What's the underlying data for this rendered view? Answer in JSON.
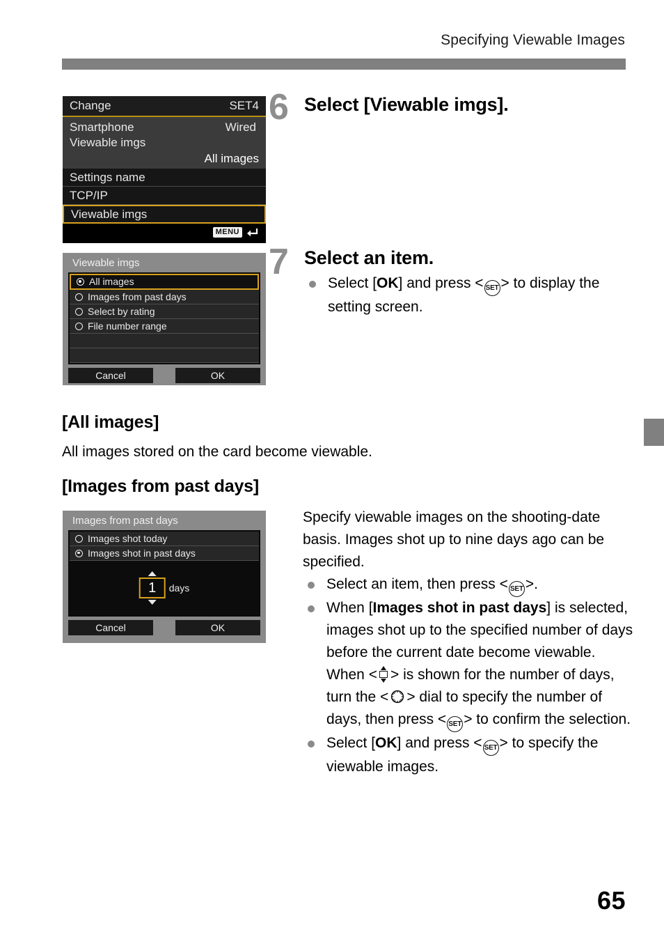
{
  "page": {
    "running_header": "Specifying Viewable Images",
    "page_number": "65"
  },
  "steps": [
    {
      "number": "6",
      "title": "Select [Viewable imgs]."
    },
    {
      "number": "7",
      "title": "Select an item.",
      "bullets": [
        {
          "parts": [
            {
              "type": "text",
              "value": "Select ["
            },
            {
              "type": "bold",
              "value": "OK"
            },
            {
              "type": "text",
              "value": "] and press <"
            },
            {
              "type": "icon",
              "value": "set-button-icon"
            },
            {
              "type": "text",
              "value": "> to display the setting screen."
            }
          ]
        }
      ]
    }
  ],
  "sections": [
    {
      "heading": "[All images]",
      "body": "All images stored on the card become viewable."
    },
    {
      "heading": "[Images from past days]",
      "intro": "Specify viewable images on the shooting-date basis. Images shot up to nine days ago can be specified.",
      "bullets": [
        "Select an item, then press <SET>.",
        "When [Images shot in past days] is selected, images shot up to the specified number of days before the current date become viewable. When <up-down-icon> is shown for the number of days, turn the <dial-icon> dial to specify the number of days, then press <SET> to confirm the selection.",
        "Select [OK] and press <SET> to specify the viewable images."
      ]
    }
  ],
  "screens": {
    "change": {
      "title": "Change",
      "set_label": "SET4",
      "rows": [
        {
          "label": "Smartphone",
          "value": "Wired"
        },
        {
          "label": "Viewable imgs",
          "value": ""
        }
      ],
      "value_right": "All images",
      "menu_items": [
        {
          "label": "Settings name",
          "selected": false
        },
        {
          "label": "TCP/IP",
          "selected": false
        },
        {
          "label": "Viewable imgs",
          "selected": true
        }
      ],
      "footer_badge": "MENU"
    },
    "viewable_imgs": {
      "title": "Viewable imgs",
      "options": [
        {
          "label": "All images",
          "checked": true,
          "selected": true
        },
        {
          "label": "Images from past days",
          "checked": false,
          "selected": false
        },
        {
          "label": "Select by rating",
          "checked": false,
          "selected": false
        },
        {
          "label": "File number range",
          "checked": false,
          "selected": false
        }
      ],
      "cancel_label": "Cancel",
      "ok_label": "OK"
    },
    "past_days": {
      "title": "Images from past days",
      "options": [
        {
          "label": "Images shot today",
          "checked": false
        },
        {
          "label": "Images shot in past days",
          "checked": true
        }
      ],
      "days_value": "1",
      "days_unit": "days",
      "cancel_label": "Cancel",
      "ok_label": "OK"
    }
  },
  "colors": {
    "rule": "#808080",
    "highlight": "#d8a21c",
    "step_number": "#8e8e8e"
  }
}
